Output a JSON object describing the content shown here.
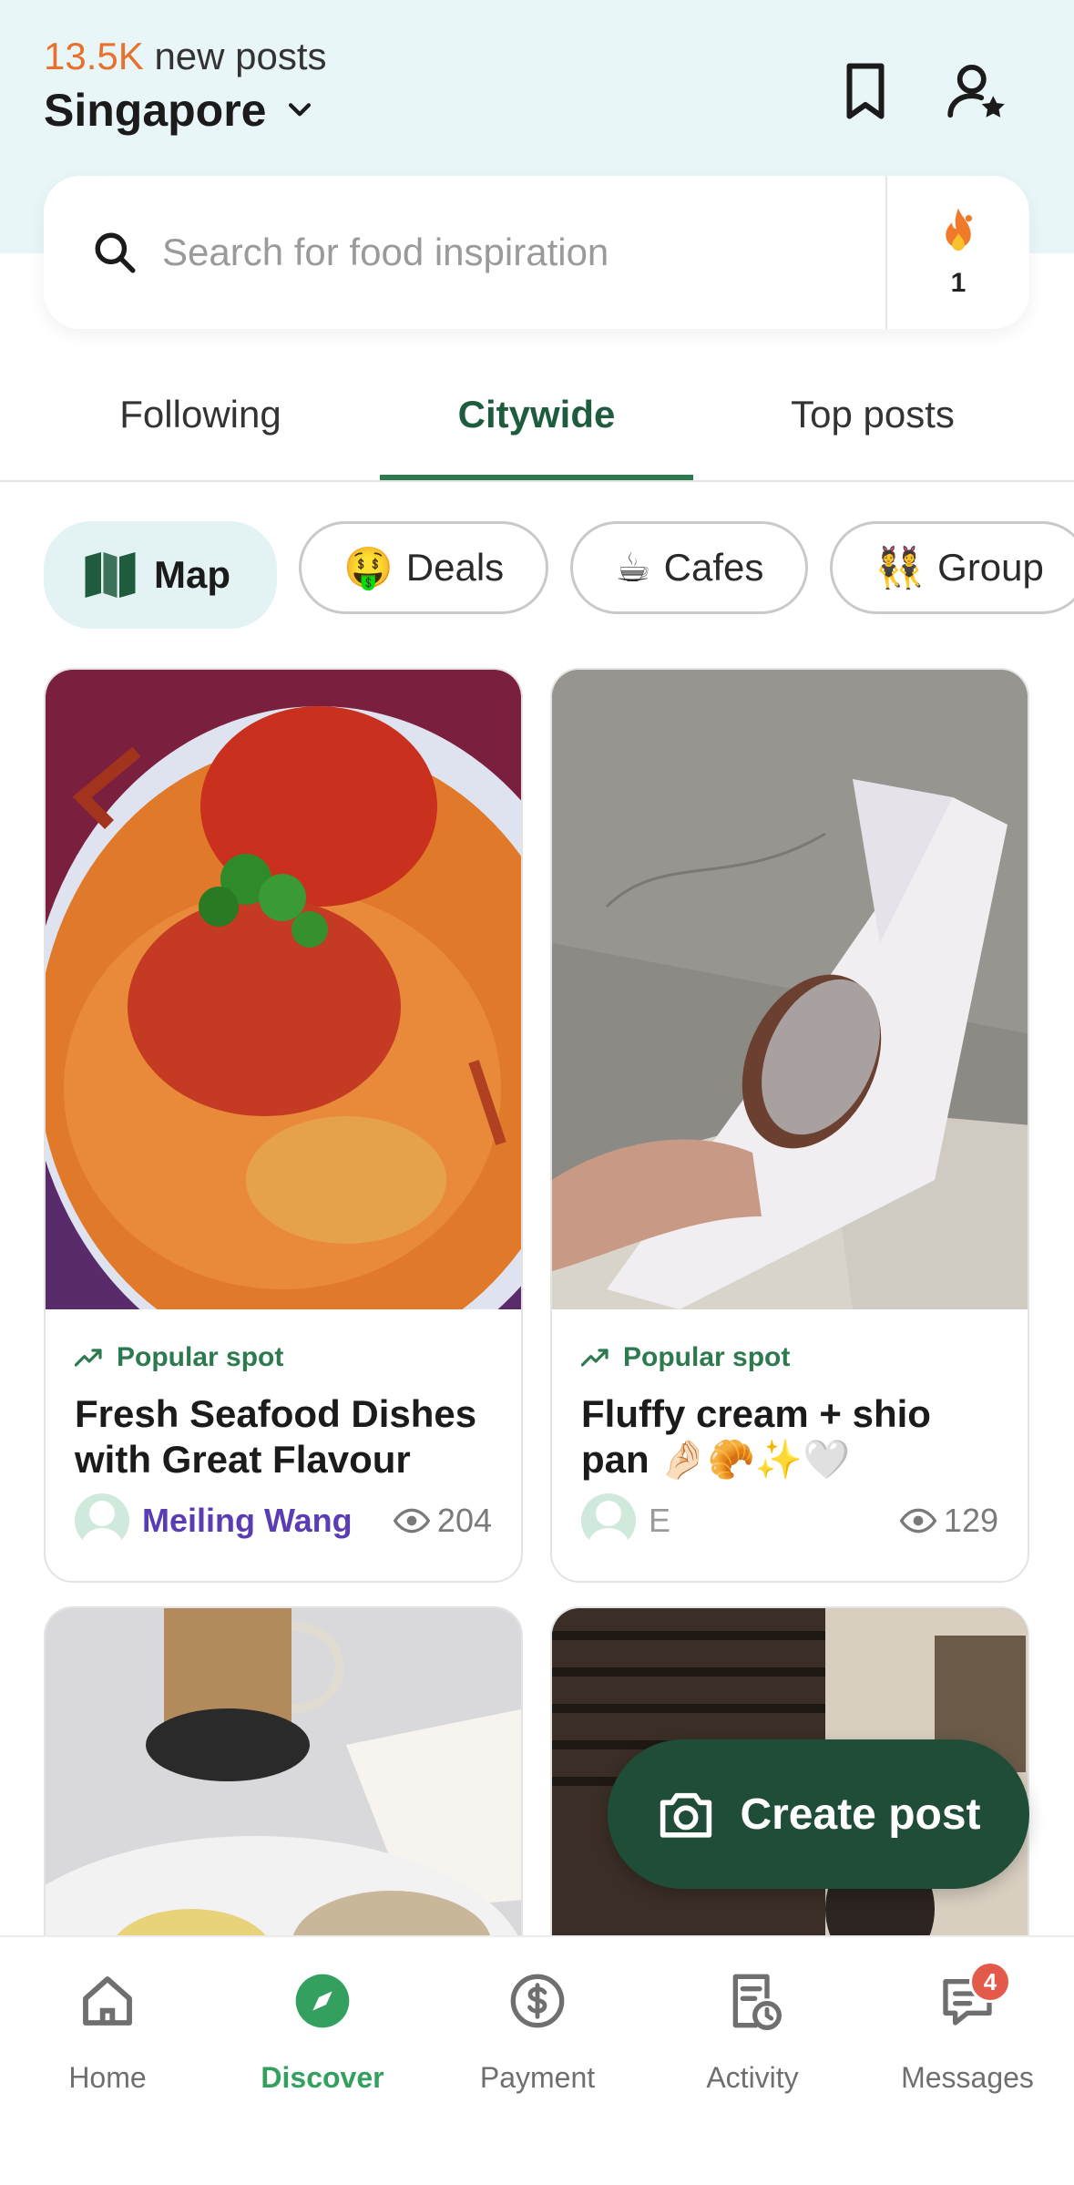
{
  "header": {
    "new_posts_count": "13.5K",
    "new_posts_label": "new posts",
    "city": "Singapore"
  },
  "search": {
    "placeholder": "Search for food inspiration",
    "streak_count": "1"
  },
  "tabs": [
    {
      "label": "Following",
      "active": false
    },
    {
      "label": "Citywide",
      "active": true
    },
    {
      "label": "Top posts",
      "active": false
    }
  ],
  "chips": [
    {
      "label": "Map",
      "icon": "map-icon"
    },
    {
      "label": "Deals",
      "emoji": "🤑"
    },
    {
      "label": "Cafes",
      "emoji": "☕"
    },
    {
      "label": "Group",
      "emoji": "👯"
    }
  ],
  "posts": [
    {
      "badge": "Popular spot",
      "title": "Fresh Seafood Dishes with Great Flavour",
      "author": "Meiling Wang",
      "views": "204"
    },
    {
      "badge": "Popular spot",
      "title": "Fluffy cream + shio pan 🤌🏻🥐✨🤍",
      "author": "E",
      "views": "129"
    }
  ],
  "fab": {
    "label": "Create post"
  },
  "nav": [
    {
      "label": "Home",
      "icon": "home-icon"
    },
    {
      "label": "Discover",
      "icon": "compass-icon",
      "active": true
    },
    {
      "label": "Payment",
      "icon": "dollar-icon"
    },
    {
      "label": "Activity",
      "icon": "activity-icon"
    },
    {
      "label": "Messages",
      "icon": "messages-icon",
      "badge": "4"
    }
  ],
  "colors": {
    "accent_green": "#2e7a4f",
    "fab_green": "#1f4d37",
    "new_posts_orange": "#e8712e",
    "header_bg": "#e9f6f8"
  }
}
